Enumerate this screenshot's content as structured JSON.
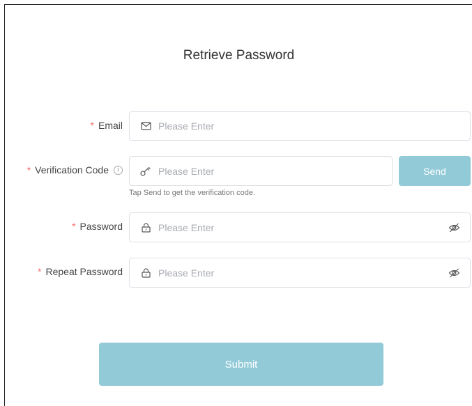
{
  "title": "Retrieve Password",
  "required_mark": "*",
  "email": {
    "label": "Email",
    "placeholder": "Please Enter",
    "icon": "envelope-icon"
  },
  "verification": {
    "label": "Verification Code",
    "info_icon": "ⓘ",
    "placeholder": "Please Enter",
    "icon": "key-icon",
    "send_label": "Send",
    "hint": "Tap Send to get the verification code."
  },
  "password": {
    "label": "Password",
    "placeholder": "Please Enter",
    "icon": "lock-icon",
    "toggle_icon": "eye-slash-icon"
  },
  "repeat_password": {
    "label": "Repeat Password",
    "placeholder": "Please Enter",
    "icon": "lock-icon",
    "toggle_icon": "eye-slash-icon"
  },
  "submit_label": "Submit",
  "colors": {
    "accent": "#92cad8",
    "required": "#f56c6c",
    "border": "#dcdfe6",
    "placeholder": "#a8abb2"
  }
}
